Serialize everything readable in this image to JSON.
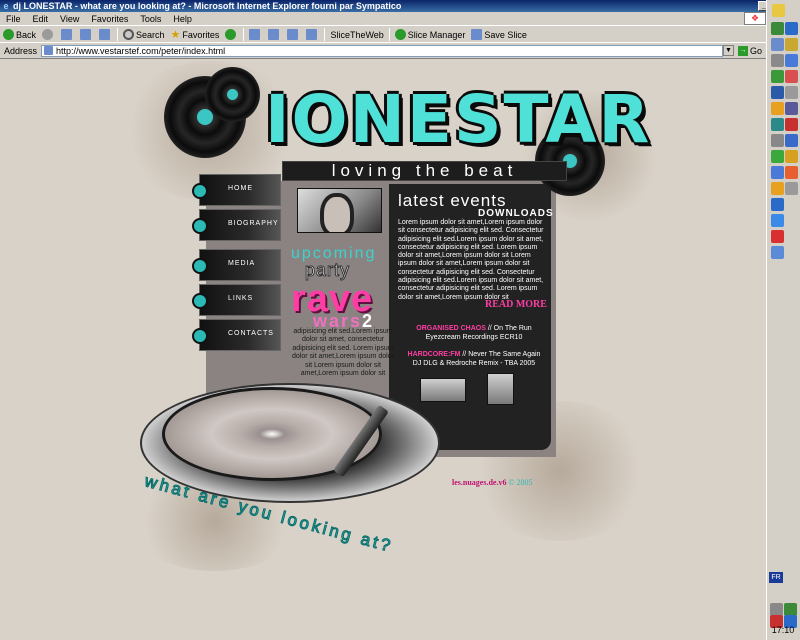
{
  "window": {
    "title": "dj LONESTAR - what are you looking at? - Microsoft Internet Explorer fourni par Sympatico",
    "controls": [
      "_",
      "□",
      "×"
    ]
  },
  "menu": [
    "File",
    "Edit",
    "View",
    "Favorites",
    "Tools",
    "Help"
  ],
  "toolbar": {
    "back": "Back",
    "search": "Search",
    "favorites": "Favorites",
    "slice_web": "SliceTheWeb",
    "slice_manager": "Slice Manager",
    "save_slice": "Save Slice"
  },
  "address": {
    "label": "Address",
    "url": "http://www.vestarstef.com/peter/index.html",
    "go": "Go"
  },
  "site": {
    "logo": "IONESTAR",
    "tagline": "loving the beat",
    "nav": [
      "HOME",
      "BIOGRAPHY",
      "MEDIA",
      "LINKS",
      "CONTACTS"
    ],
    "upcoming": "upcoming",
    "party": "party",
    "rave": "rave",
    "wars": "wars",
    "wars_num": "2",
    "party_text": "adipisicing elit sed.Lorem ipsum dolor sit amet, consectetur adipisicing elit sed. Lorem ipsum dolor sit amet,Lorem ipsum dolor sit Lorem ipsum dolor sit amet,Lorem ipsum dolor sit",
    "events_title": "latest events",
    "downloads": "DOWNLOADS",
    "events_text": "Lorem ipsum dolor sit amet,Lorem ipsum dolor sit consectetur adipisicing elit sed. Consectetur adipisicing elit sed.Lorem ipsum dolor sit amet, consectetur adipisicing elit sed. Lorem ipsum dolor sit amet,Lorem ipsum dolor sit Lorem ipsum dolor sit amet,Lorem ipsum dolor sit consectetur adipisicing elit sed. Consectetur adipisicing elit sed.Lorem ipsum dolor sit amet, consectetur adipisicing elit sed. Lorem ipsum dolor sit amet,Lorem ipsum dolor sit",
    "read_more": "READ MORE",
    "downloads_list": [
      {
        "name": "ORGANISED CHAOS",
        "track": " // On The Run",
        "label": "Eyezcream Recordings ECR10"
      },
      {
        "name": "HARDCORE:FM",
        "track": " // Never The Same Again",
        "label": "DJ DLG & Redroche Remix - TBA 2005"
      }
    ],
    "bottom_tagline": "what are you looking at?",
    "credits_name": "les.nuages.de.v6",
    "credits_year": " © 2005"
  },
  "taskbar": {
    "lang": "FR",
    "clock": "17:10"
  },
  "colors": {
    "accent_teal": "#3bd3cd",
    "accent_pink": "#ff3ea5",
    "page_bg": "#d9d2c8"
  }
}
